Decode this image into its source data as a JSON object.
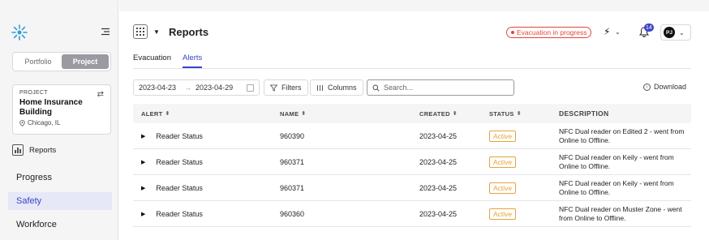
{
  "sidebar": {
    "switch": [
      "Portfolio",
      "Project"
    ],
    "project_card": {
      "label": "PROJECT",
      "name": "Home Insurance Building",
      "location": "Chicago, IL"
    },
    "reports_label": "Reports",
    "nav": [
      {
        "label": "Progress"
      },
      {
        "label": "Safety"
      },
      {
        "label": "Workforce"
      }
    ]
  },
  "header": {
    "title": "Reports",
    "evacuation_badge": "Evacuation in progress",
    "notifications_count": "14",
    "avatar_initials": "PJ"
  },
  "tabs": [
    "Evacuation",
    "Alerts"
  ],
  "toolbar": {
    "date_from": "2023-04-23",
    "date_to": "2023-04-29",
    "filters_label": "Filters",
    "columns_label": "Columns",
    "search_placeholder": "Search...",
    "download_label": "Download"
  },
  "table": {
    "columns": [
      "ALERT",
      "NAME",
      "CREATED",
      "STATUS",
      "DESCRIPTION"
    ],
    "rows": [
      {
        "alert": "Reader Status",
        "name": "960390",
        "created": "2023-04-25",
        "status": "Active",
        "description": "NFC Dual reader on Edited 2 - went from Online to Offline."
      },
      {
        "alert": "Reader Status",
        "name": "960371",
        "created": "2023-04-25",
        "status": "Active",
        "description": "NFC Dual reader on Keily - went from Online to Offline."
      },
      {
        "alert": "Reader Status",
        "name": "960371",
        "created": "2023-04-25",
        "status": "Active",
        "description": "NFC Dual reader on Keily - went from Online to Offline."
      },
      {
        "alert": "Reader Status",
        "name": "960360",
        "created": "2023-04-25",
        "status": "Active",
        "description": "NFC Dual reader on Muster Zone - went from Online to Offline."
      }
    ]
  },
  "colors": {
    "accent": "#3b44c7",
    "alert_red": "#e0483a",
    "status_orange": "#e5a33c"
  },
  "icons": [
    "sun-logo-icon",
    "collapse-menu-icon",
    "swap-icon",
    "location-pin-icon",
    "chart-icon",
    "apps-grid-icon",
    "chevron-down-icon",
    "bolt-icon",
    "bell-icon",
    "calendar-icon",
    "filter-icon",
    "columns-icon",
    "search-icon",
    "download-icon",
    "expand-row-icon",
    "sort-icon"
  ]
}
